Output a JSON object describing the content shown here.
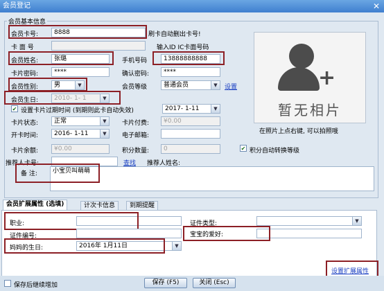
{
  "window": {
    "title": "会员登记"
  },
  "basic": {
    "group_title": "会员基本信息",
    "card_no_label": "会员卡号:",
    "card_no_value": "8888",
    "card_no_hint": "刷卡自动删出卡号!",
    "card_face_label": "卡 面 号",
    "card_face_hint": "输入ID IC卡面号码",
    "name_label": "会员姓名:",
    "name_value": "张璐",
    "phone_label": "手机号码",
    "phone_value": "13888888888",
    "password_label": "卡片密码:",
    "password_value": "****",
    "confirm_label": "确认密码:",
    "confirm_value": "****",
    "gender_label": "会员性别:",
    "gender_value": "男",
    "level_label": "会员等级",
    "level_value": "普通会员",
    "level_link": "设置",
    "birthday_label": "会员生日:",
    "birthday_value": "2010- 1- 1",
    "expiry_check_label": "设置卡片过期时间 (到期则此卡自动失效)",
    "expiry_value": "2017- 1-11",
    "status_label": "卡片状态:",
    "status_value": "正常",
    "fee_label": "卡片付费:",
    "fee_value": "¥0.00",
    "open_label": "开卡时间:",
    "open_value": "2016- 1-11",
    "email_label": "电子邮箱:",
    "email_value": "",
    "balance_label": "卡片余额:",
    "balance_value": "¥0.00",
    "points_label": "积分数量:",
    "points_value": "0",
    "auto_level_label": "积分自动转换等级",
    "referrer_label": "推荐人卡号:",
    "referrer_value": "",
    "search_link": "查找",
    "referrer_name_label": "推荐人姓名:",
    "remark_label": "备  注:",
    "remark_value": "小宝贝叫萌萌"
  },
  "photo": {
    "no_photo_text": "暂无相片",
    "hint": "在照片上点右键, 可以拍照哦"
  },
  "tabs": [
    {
      "label": "会员扩展属性 (选填)"
    },
    {
      "label": "计次卡信息"
    },
    {
      "label": "到期提醒"
    }
  ],
  "ext": {
    "job_label": "职业:",
    "job_value": "",
    "id_type_label": "证件类型:",
    "id_type_value": "",
    "id_no_label": "证件编号:",
    "id_no_value": "",
    "hobby_label": "宝宝的爱好:",
    "hobby_value": "",
    "mom_birthday_label": "妈妈的生日:",
    "mom_birthday_value": "2016年 1月11日",
    "ext_settings_link": "设置扩展属性"
  },
  "footer": {
    "keep_adding_label": "保存后继续增加",
    "save_label": "保存 (F5)",
    "close_label": "关闭 (Esc)"
  },
  "icons": {
    "dropdown": "chevron-down-icon",
    "check": "checkmark-icon",
    "avatar": "person-add-icon"
  }
}
